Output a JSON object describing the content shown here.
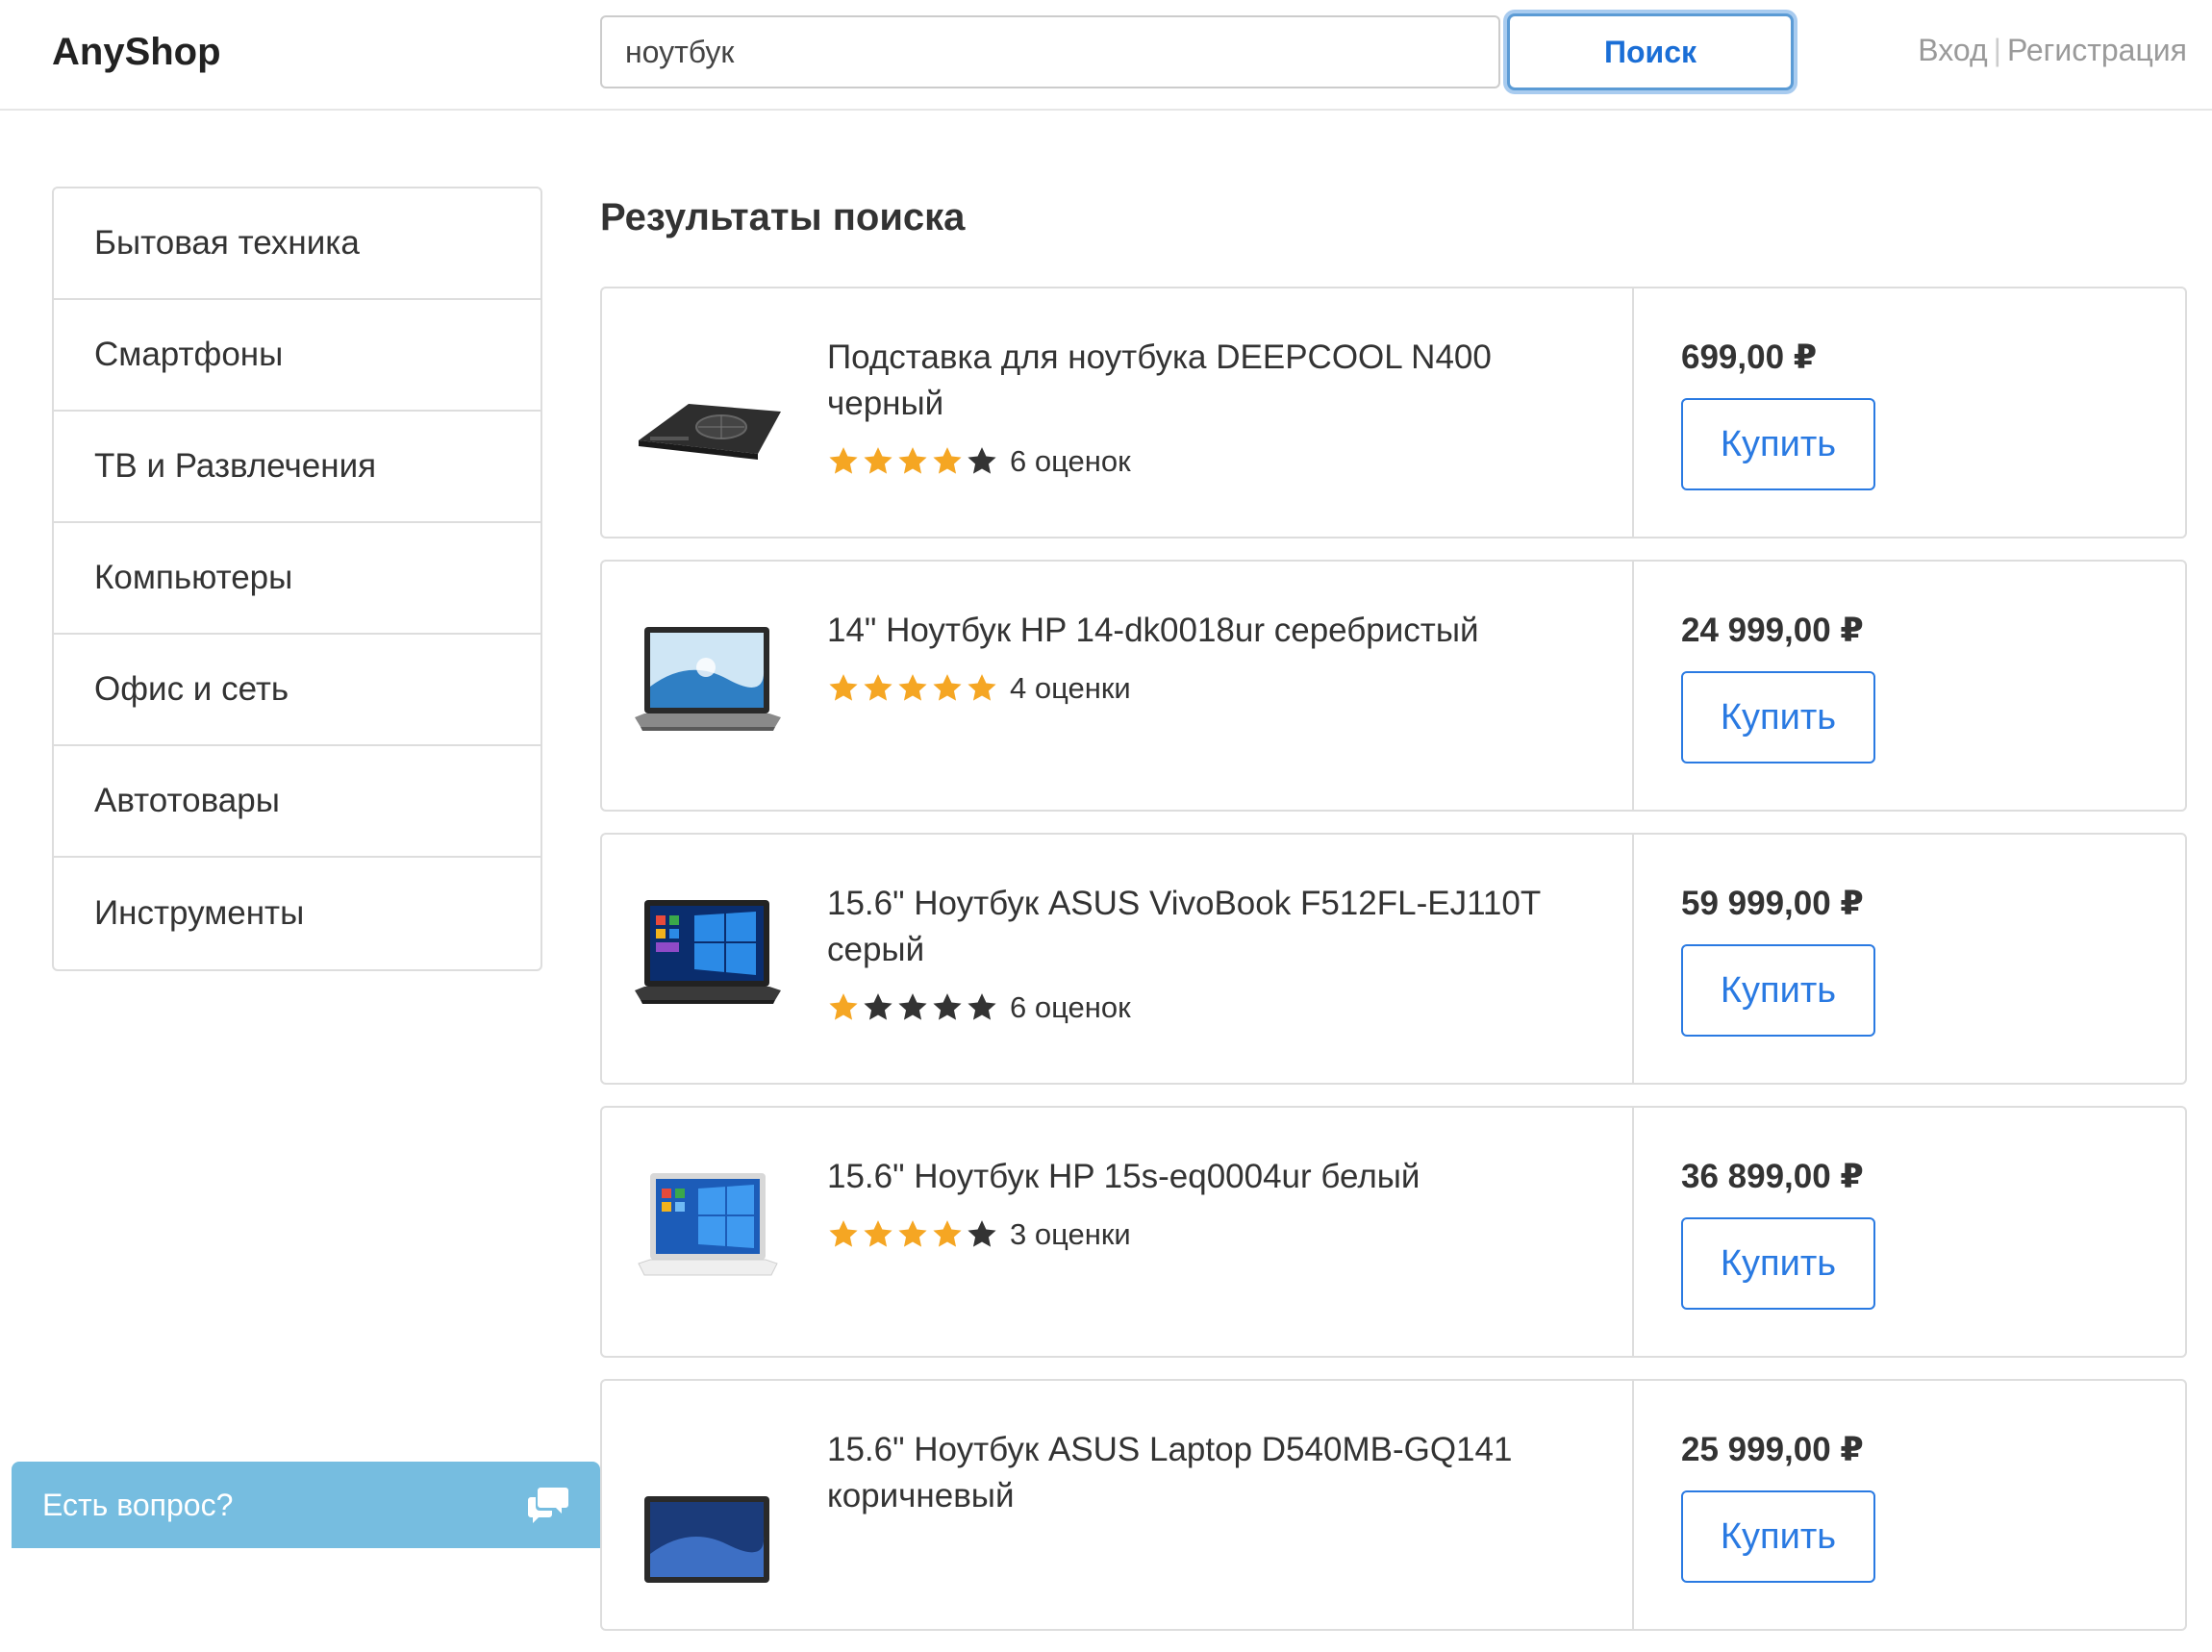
{
  "header": {
    "logo": "AnyShop",
    "search_value": "ноутбук",
    "search_button": "Поиск",
    "login": "Вход",
    "separator": "|",
    "register": "Регистрация"
  },
  "sidebar": {
    "items": [
      {
        "label": "Бытовая техника"
      },
      {
        "label": "Смартфоны"
      },
      {
        "label": "ТВ и Развлечения"
      },
      {
        "label": "Компьютеры"
      },
      {
        "label": "Офис и сеть"
      },
      {
        "label": "Автотовары"
      },
      {
        "label": "Инструменты"
      }
    ]
  },
  "main": {
    "title": "Результаты поиска",
    "buy_label": "Купить",
    "results": [
      {
        "title": "Подставка для ноутбука DEEPCOOL N400 черный",
        "rating": 4,
        "reviews": "6 оценок",
        "price": "699,00 ₽",
        "image": "laptop-stand"
      },
      {
        "title": "14\" Ноутбук HP 14-dk0018ur серебристый",
        "rating": 5,
        "reviews": "4 оценки",
        "price": "24 999,00 ₽",
        "image": "laptop-hp-silver"
      },
      {
        "title": "15.6\" Ноутбук ASUS VivoBook F512FL-EJ110T серый",
        "rating": 1,
        "reviews": "6 оценок",
        "price": "59 999,00 ₽",
        "image": "laptop-asus-grey"
      },
      {
        "title": "15.6\" Ноутбук HP 15s-eq0004ur белый",
        "rating": 4,
        "reviews": "3 оценки",
        "price": "36 899,00 ₽",
        "image": "laptop-hp-white"
      },
      {
        "title": "15.6\" Ноутбук ASUS Laptop D540MB-GQ141 коричневый",
        "rating": 0,
        "reviews": "",
        "price": "25 999,00 ₽",
        "image": "laptop-asus-brown"
      }
    ]
  },
  "chat": {
    "label": "Есть вопрос?",
    "icon": "chat-bubbles-icon"
  },
  "colors": {
    "accent": "#2a7ae2",
    "star_filled": "#f5a623",
    "star_empty": "#333333",
    "chat_bg": "#76bde0"
  }
}
